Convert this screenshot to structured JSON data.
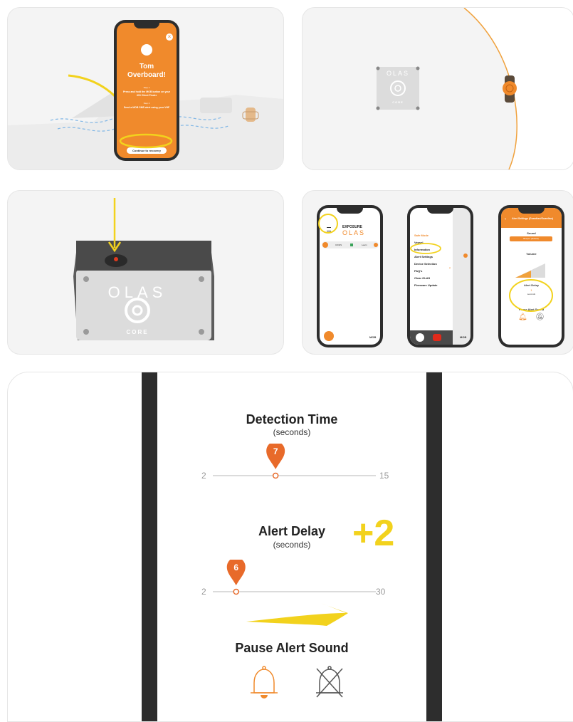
{
  "colors": {
    "orange": "#f08a2c",
    "pin_orange": "#e86a2a",
    "yellow": "#f2d21d",
    "dark": "#2d2d2d",
    "grey_bg": "#f4f4f4"
  },
  "panel1": {
    "alert_title": "Tom Overboard!",
    "step1_label": "Step 1",
    "step1_text": "Press and hold the MOB button on your iOS Client Finder",
    "step2_label": "Step 2",
    "step2_text": "Send a MOB SMS alert using your VHF",
    "continue_button": "Continue to recovery"
  },
  "panel2": {
    "device_brand": "OLAS",
    "device_model": "CORE"
  },
  "panel3": {
    "device_brand": "OLAS",
    "device_model": "CORE"
  },
  "panel4": {
    "phone_a": {
      "brand_top": "EXPOSURE",
      "brand_bottom": "OLAS",
      "row_name": "OASIS",
      "row_status": "Learn",
      "mob_label": "MOB"
    },
    "phone_b": {
      "menu_items": [
        "Safe Mode",
        "Vessel",
        "Information",
        "Alert Settings",
        "Device Selection",
        "FAQ's",
        "Clear OLAS",
        "Firmware Update"
      ],
      "mob_label": "MOB"
    },
    "phone_c": {
      "header": "Alert Settings (Guardian/Guardian)",
      "sound_label": "Sound",
      "sound_value": "Beeper (default)",
      "volume_label": "Volume",
      "alert_delay_label": "Alert Delay",
      "alert_delay_value": "1",
      "alert_delay_unit": "seconds",
      "pause_label": "Pause Alert Sound"
    }
  },
  "panel5": {
    "detection_title": "Detection Time",
    "detection_unit": "(seconds)",
    "detection_value": "7",
    "detection_min": "2",
    "detection_max": "15",
    "detection_fraction": 0.385,
    "delay_title": "Alert Delay",
    "delay_unit": "(seconds)",
    "delay_increment": "+2",
    "delay_value": "6",
    "delay_min": "2",
    "delay_max": "30",
    "delay_fraction": 0.143,
    "pause_title": "Pause Alert Sound"
  }
}
